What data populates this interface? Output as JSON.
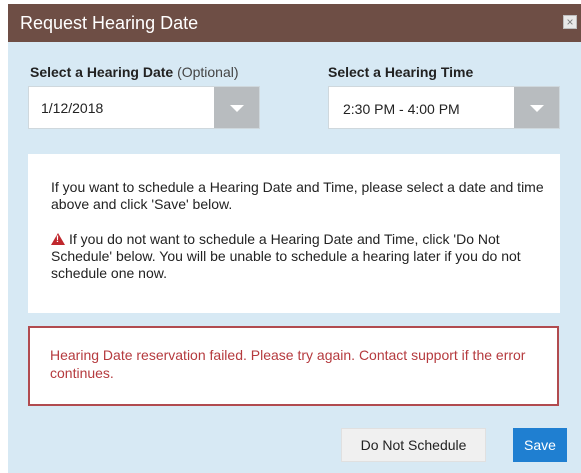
{
  "dialog": {
    "title": "Request Hearing Date",
    "close_label": "×"
  },
  "date_select": {
    "label": "Select a Hearing Date",
    "label_optional": "(Optional)",
    "value": "1/12/2018"
  },
  "time_select": {
    "label": "Select a Hearing Time",
    "value": "2:30 PM - 4:00 PM"
  },
  "info": {
    "paragraph1": "If you want to schedule a Hearing Date and Time, please select a date and time above and click 'Save' below.",
    "paragraph2": "If you do not want to schedule a Hearing Date and Time, click 'Do Not Schedule' below. You will be unable to schedule a hearing later if you do not schedule one now."
  },
  "error": {
    "message": "Hearing Date reservation failed. Please try again. Contact support if the error continues."
  },
  "buttons": {
    "do_not_schedule": "Do Not Schedule",
    "save": "Save"
  },
  "colors": {
    "titlebar": "#6e4e45",
    "dialog_bg": "#d7e9f4",
    "error_border": "#b14b4f",
    "error_text": "#b53a3e",
    "save_button": "#1f7fd1",
    "warning_icon": "#c0282d"
  },
  "icons": {
    "close": "close-icon",
    "dropdown": "chevron-down-icon",
    "warning": "warning-icon"
  }
}
